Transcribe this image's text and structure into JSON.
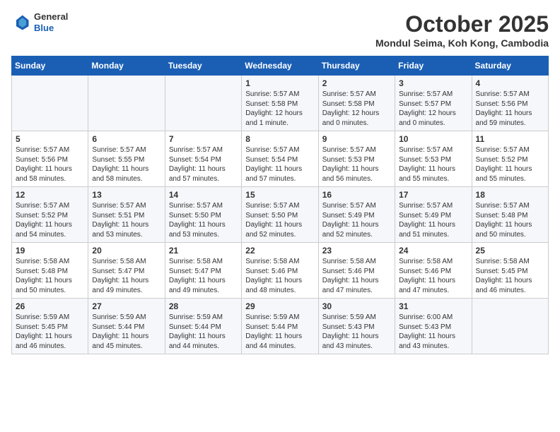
{
  "header": {
    "logo": {
      "general": "General",
      "blue": "Blue"
    },
    "title": "October 2025",
    "subtitle": "Mondul Seima, Koh Kong, Cambodia"
  },
  "days_of_week": [
    "Sunday",
    "Monday",
    "Tuesday",
    "Wednesday",
    "Thursday",
    "Friday",
    "Saturday"
  ],
  "weeks": [
    [
      {
        "day": "",
        "info": ""
      },
      {
        "day": "",
        "info": ""
      },
      {
        "day": "",
        "info": ""
      },
      {
        "day": "1",
        "info": "Sunrise: 5:57 AM\nSunset: 5:58 PM\nDaylight: 12 hours\nand 1 minute."
      },
      {
        "day": "2",
        "info": "Sunrise: 5:57 AM\nSunset: 5:58 PM\nDaylight: 12 hours\nand 0 minutes."
      },
      {
        "day": "3",
        "info": "Sunrise: 5:57 AM\nSunset: 5:57 PM\nDaylight: 12 hours\nand 0 minutes."
      },
      {
        "day": "4",
        "info": "Sunrise: 5:57 AM\nSunset: 5:56 PM\nDaylight: 11 hours\nand 59 minutes."
      }
    ],
    [
      {
        "day": "5",
        "info": "Sunrise: 5:57 AM\nSunset: 5:56 PM\nDaylight: 11 hours\nand 58 minutes."
      },
      {
        "day": "6",
        "info": "Sunrise: 5:57 AM\nSunset: 5:55 PM\nDaylight: 11 hours\nand 58 minutes."
      },
      {
        "day": "7",
        "info": "Sunrise: 5:57 AM\nSunset: 5:54 PM\nDaylight: 11 hours\nand 57 minutes."
      },
      {
        "day": "8",
        "info": "Sunrise: 5:57 AM\nSunset: 5:54 PM\nDaylight: 11 hours\nand 57 minutes."
      },
      {
        "day": "9",
        "info": "Sunrise: 5:57 AM\nSunset: 5:53 PM\nDaylight: 11 hours\nand 56 minutes."
      },
      {
        "day": "10",
        "info": "Sunrise: 5:57 AM\nSunset: 5:53 PM\nDaylight: 11 hours\nand 55 minutes."
      },
      {
        "day": "11",
        "info": "Sunrise: 5:57 AM\nSunset: 5:52 PM\nDaylight: 11 hours\nand 55 minutes."
      }
    ],
    [
      {
        "day": "12",
        "info": "Sunrise: 5:57 AM\nSunset: 5:52 PM\nDaylight: 11 hours\nand 54 minutes."
      },
      {
        "day": "13",
        "info": "Sunrise: 5:57 AM\nSunset: 5:51 PM\nDaylight: 11 hours\nand 53 minutes."
      },
      {
        "day": "14",
        "info": "Sunrise: 5:57 AM\nSunset: 5:50 PM\nDaylight: 11 hours\nand 53 minutes."
      },
      {
        "day": "15",
        "info": "Sunrise: 5:57 AM\nSunset: 5:50 PM\nDaylight: 11 hours\nand 52 minutes."
      },
      {
        "day": "16",
        "info": "Sunrise: 5:57 AM\nSunset: 5:49 PM\nDaylight: 11 hours\nand 52 minutes."
      },
      {
        "day": "17",
        "info": "Sunrise: 5:57 AM\nSunset: 5:49 PM\nDaylight: 11 hours\nand 51 minutes."
      },
      {
        "day": "18",
        "info": "Sunrise: 5:57 AM\nSunset: 5:48 PM\nDaylight: 11 hours\nand 50 minutes."
      }
    ],
    [
      {
        "day": "19",
        "info": "Sunrise: 5:58 AM\nSunset: 5:48 PM\nDaylight: 11 hours\nand 50 minutes."
      },
      {
        "day": "20",
        "info": "Sunrise: 5:58 AM\nSunset: 5:47 PM\nDaylight: 11 hours\nand 49 minutes."
      },
      {
        "day": "21",
        "info": "Sunrise: 5:58 AM\nSunset: 5:47 PM\nDaylight: 11 hours\nand 49 minutes."
      },
      {
        "day": "22",
        "info": "Sunrise: 5:58 AM\nSunset: 5:46 PM\nDaylight: 11 hours\nand 48 minutes."
      },
      {
        "day": "23",
        "info": "Sunrise: 5:58 AM\nSunset: 5:46 PM\nDaylight: 11 hours\nand 47 minutes."
      },
      {
        "day": "24",
        "info": "Sunrise: 5:58 AM\nSunset: 5:46 PM\nDaylight: 11 hours\nand 47 minutes."
      },
      {
        "day": "25",
        "info": "Sunrise: 5:58 AM\nSunset: 5:45 PM\nDaylight: 11 hours\nand 46 minutes."
      }
    ],
    [
      {
        "day": "26",
        "info": "Sunrise: 5:59 AM\nSunset: 5:45 PM\nDaylight: 11 hours\nand 46 minutes."
      },
      {
        "day": "27",
        "info": "Sunrise: 5:59 AM\nSunset: 5:44 PM\nDaylight: 11 hours\nand 45 minutes."
      },
      {
        "day": "28",
        "info": "Sunrise: 5:59 AM\nSunset: 5:44 PM\nDaylight: 11 hours\nand 44 minutes."
      },
      {
        "day": "29",
        "info": "Sunrise: 5:59 AM\nSunset: 5:44 PM\nDaylight: 11 hours\nand 44 minutes."
      },
      {
        "day": "30",
        "info": "Sunrise: 5:59 AM\nSunset: 5:43 PM\nDaylight: 11 hours\nand 43 minutes."
      },
      {
        "day": "31",
        "info": "Sunrise: 6:00 AM\nSunset: 5:43 PM\nDaylight: 11 hours\nand 43 minutes."
      },
      {
        "day": "",
        "info": ""
      }
    ]
  ]
}
